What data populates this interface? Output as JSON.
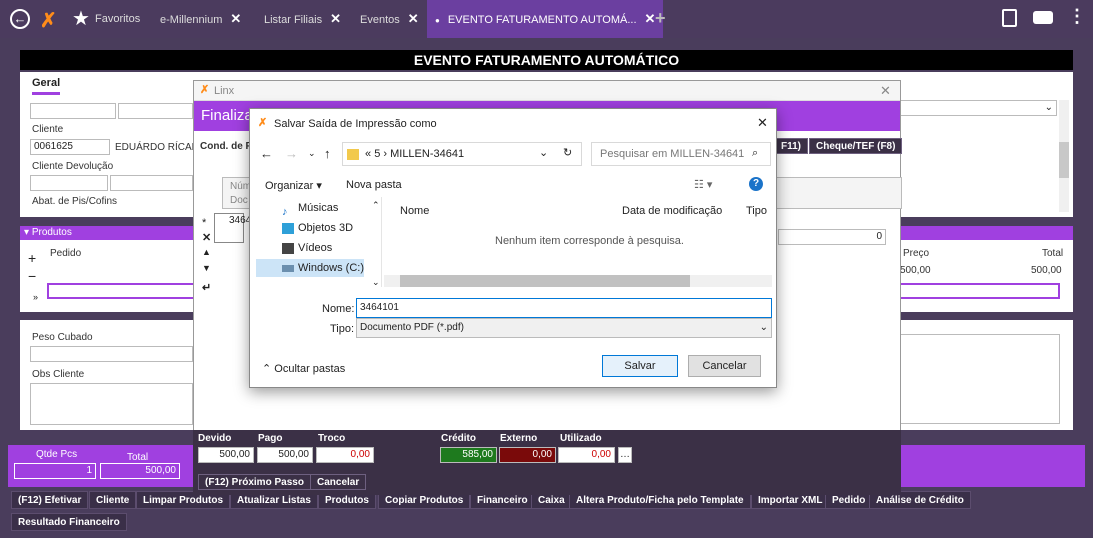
{
  "topbar": {
    "favorites": "Favoritos",
    "tabs": [
      "e-Millennium",
      "Listar Filiais",
      "Eventos",
      "EVENTO FATURAMENTO AUTOMÁ..."
    ]
  },
  "page_title": "EVENTO FATURAMENTO AUTOMÁTICO",
  "geral": {
    "tab": "Geral",
    "cliente_label": "Cliente",
    "cliente_code": "0061625",
    "cliente_name": "EDUÁRDO RÍCARD",
    "devolucao_label": "Cliente Devolução",
    "abat_label": "Abat. de Pis/Cofins"
  },
  "produtos": {
    "title": "Produtos",
    "pedido_col": "Pedido",
    "preco_col": "Preço",
    "total_col": "Total",
    "preco_val": "500,00",
    "total_val": "500,00"
  },
  "obs": {
    "peso": "Peso Cubado",
    "obs_cliente": "Obs Cliente"
  },
  "totals": {
    "qtde_label": "Qtde Pcs",
    "qtde_val": "1",
    "total_label": "Total",
    "total_val": "500,00"
  },
  "linx": {
    "title": "Linx",
    "finaliza": "Finaliza",
    "cond": "Cond. de Pa",
    "f11": "F11)",
    "cheque": "Cheque/TEF (F8)",
    "num": "Núm",
    "doc": "Doc",
    "row_val": "3464",
    "field0": "0",
    "devido_label": "Devido",
    "devido_val": "500,00",
    "pago_label": "Pago",
    "pago_val": "500,00",
    "troco_label": "Troco",
    "troco_val": "0,00",
    "credito_label": "Crédito",
    "credito_val": "585,00",
    "externo_label": "Externo",
    "externo_val": "0,00",
    "utilizado_label": "Utilizado",
    "utilizado_val": "0,00",
    "next": "(F12) Próximo Passo",
    "cancel": "Cancelar"
  },
  "dialog": {
    "title": "Salvar Saída de Impressão como",
    "path_prefix": "«",
    "path_a": "5",
    "path_b": "MILLEN-34641",
    "search_placeholder": "Pesquisar em MILLEN-34641",
    "organize": "Organizar",
    "new_folder": "Nova pasta",
    "nav": [
      "Músicas",
      "Objetos 3D",
      "Vídeos",
      "Windows (C:)"
    ],
    "col_name": "Nome",
    "col_date": "Data de modificação",
    "col_type": "Tipo",
    "empty": "Nenhum item corresponde à pesquisa.",
    "name_label": "Nome:",
    "name_value": "3464101",
    "type_label": "Tipo:",
    "type_value": "Documento PDF (*.pdf)",
    "hide_folders": "Ocultar pastas",
    "save": "Salvar",
    "cancel": "Cancelar"
  },
  "bottom_buttons": [
    "(F12) Efetivar",
    "Cliente",
    "Limpar Produtos",
    "Atualizar Listas",
    "Produtos",
    "Copiar Produtos",
    "Financeiro",
    "Caixa",
    "Altera Produto/Ficha pelo Template",
    "Importar XML",
    "Pedido",
    "Análise de Crédito",
    "Resultado Financeiro"
  ]
}
